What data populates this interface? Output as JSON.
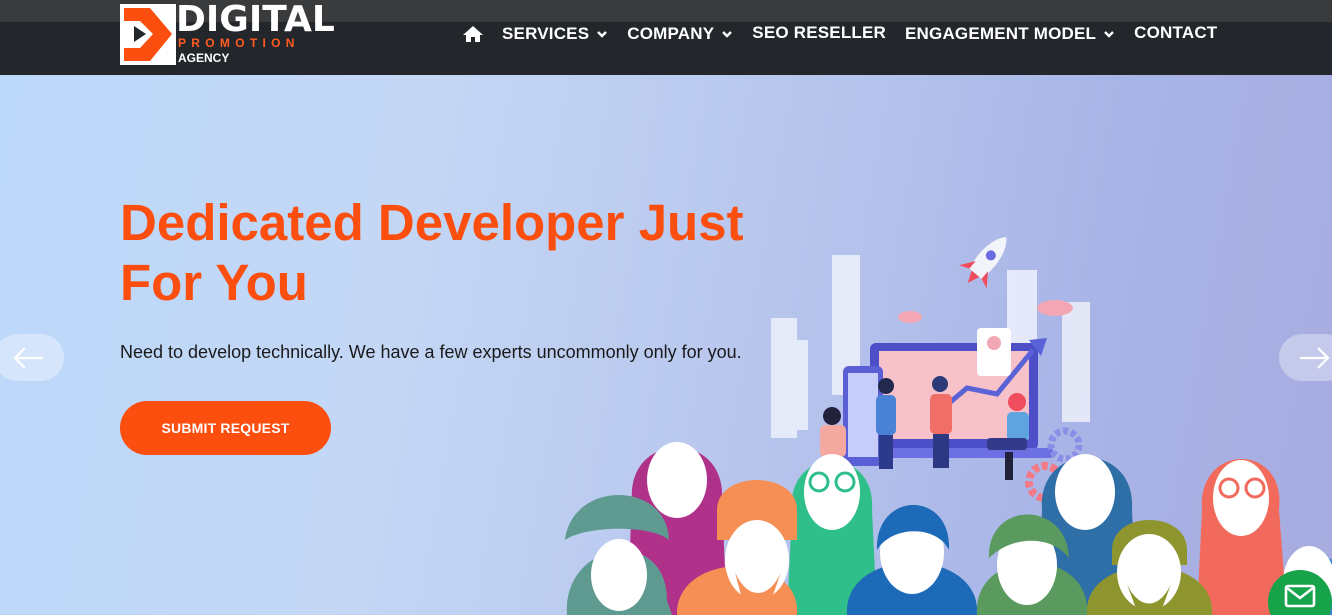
{
  "brand": {
    "name": "DIGITAL",
    "tagline": "PROMOTION",
    "suffix": "AGENCY",
    "colors": {
      "accent": "#fb4e0f",
      "nav_bg": "#23262b",
      "white": "#ffffff"
    }
  },
  "nav": {
    "home_icon": "home-icon",
    "items": [
      {
        "label": "SERVICES",
        "has_dropdown": true
      },
      {
        "label": "COMPANY",
        "has_dropdown": true
      },
      {
        "label": "SEO RESELLER",
        "has_dropdown": false
      },
      {
        "label": "ENGAGEMENT MODEL",
        "has_dropdown": true
      },
      {
        "label": "CONTACT",
        "has_dropdown": false
      }
    ]
  },
  "hero": {
    "headline": "Dedicated Developer Just For You",
    "subtext": "Need to develop technically. We have a few experts uncommonly only for you.",
    "cta_label": "SUBMIT REQUEST",
    "prev_icon": "arrow-left-icon",
    "next_icon": "arrow-right-icon"
  },
  "floating": {
    "mail_icon": "mail-icon"
  }
}
